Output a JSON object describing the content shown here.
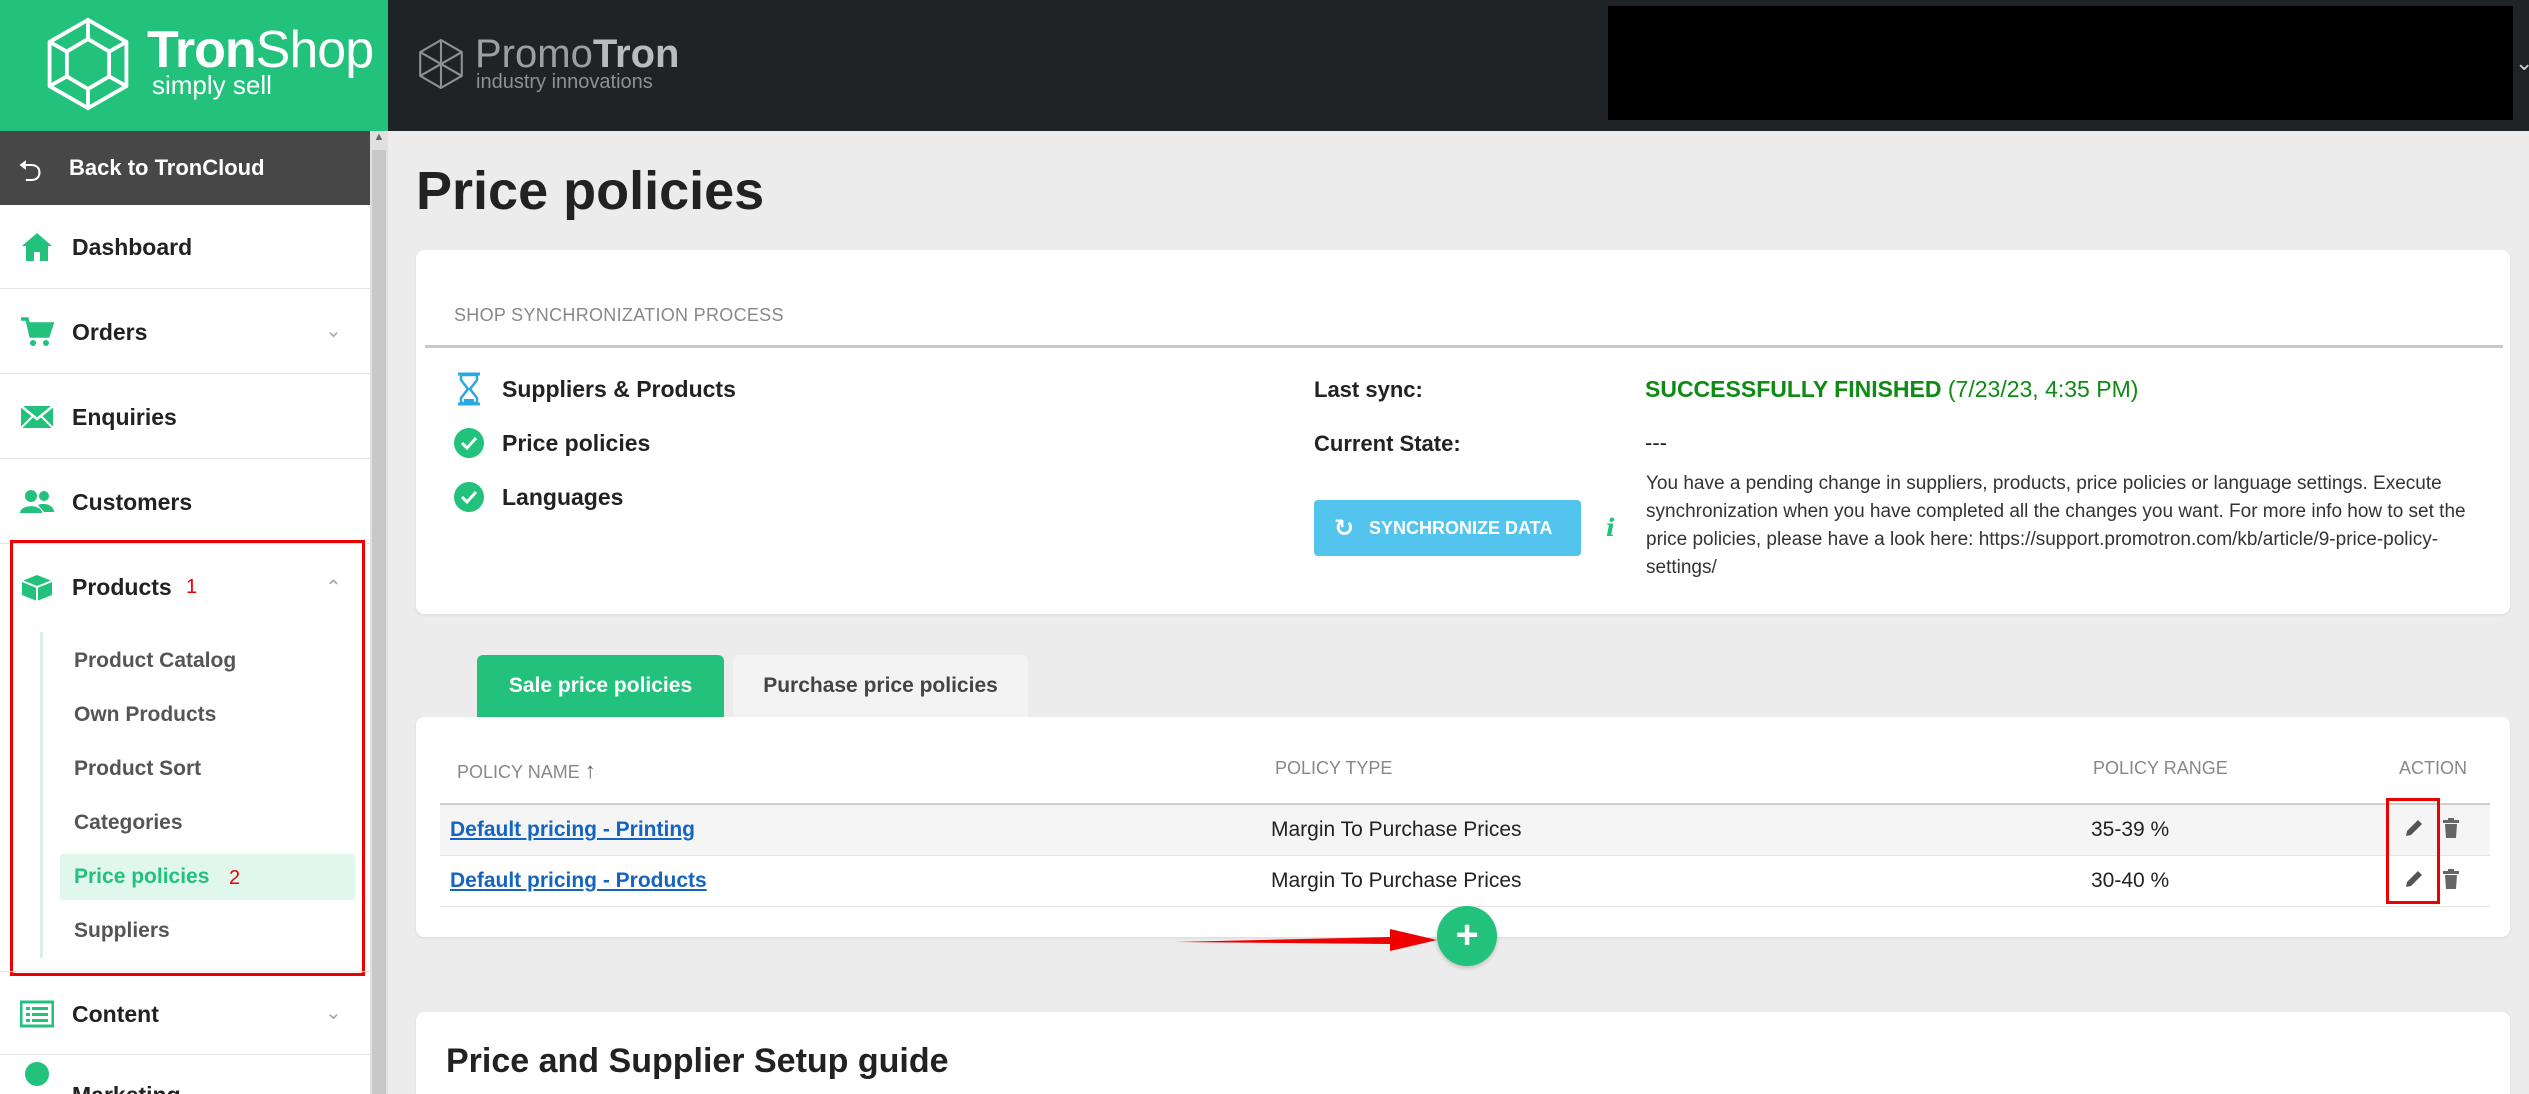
{
  "brand": {
    "logo_bold": "Tron",
    "logo_rest": "Shop",
    "logo_sub": "simply sell",
    "partner_left": "Promo",
    "partner_right": "Tron",
    "partner_sub": "industry innovations",
    "accent": "#22c17c"
  },
  "sidebar": {
    "back_label": "Back to TronCloud",
    "items": [
      {
        "label": "Dashboard",
        "icon": "home-icon"
      },
      {
        "label": "Orders",
        "icon": "cart-icon"
      },
      {
        "label": "Enquiries",
        "icon": "envelope-icon"
      },
      {
        "label": "Customers",
        "icon": "users-icon"
      },
      {
        "label": "Products",
        "icon": "box-icon"
      },
      {
        "label": "Content",
        "icon": "list-icon"
      },
      {
        "label": "Marketing",
        "icon": "marketing-icon"
      }
    ],
    "products_sub": [
      "Product Catalog",
      "Own Products",
      "Product Sort",
      "Categories",
      "Price policies",
      "Suppliers"
    ],
    "annotation_1": "1",
    "annotation_2": "2"
  },
  "page": {
    "title": "Price policies"
  },
  "sync": {
    "heading": "SHOP SYNCHRONIZATION PROCESS",
    "items": [
      "Suppliers & Products",
      "Price policies",
      "Languages"
    ],
    "last_sync_label": "Last sync:",
    "last_sync_status": "SUCCESSFULLY FINISHED",
    "last_sync_time": "(7/23/23, 4:35 PM)",
    "current_state_label": "Current State:",
    "current_state_value": "---",
    "button_label": "SYNCHRONIZE DATA",
    "pending_text": "You have a pending change in suppliers, products, price policies or language settings. Execute synchronization when you have completed all the changes you want. For more info how to set the price policies, please have a look here: https://support.promotron.com/kb/article/9-price-policy-settings/"
  },
  "tabs": [
    "Sale price policies",
    "Purchase price policies"
  ],
  "table": {
    "columns": [
      "POLICY NAME",
      "POLICY TYPE",
      "POLICY RANGE",
      "ACTION"
    ],
    "sort_indicator": "↑",
    "rows": [
      {
        "name": "Default pricing - Printing",
        "type": "Margin To Purchase Prices",
        "range": "35-39 %"
      },
      {
        "name": "Default pricing - Products",
        "type": "Margin To Purchase Prices",
        "range": "30-40 %"
      }
    ]
  },
  "guide": {
    "title": "Price and Supplier Setup guide"
  }
}
